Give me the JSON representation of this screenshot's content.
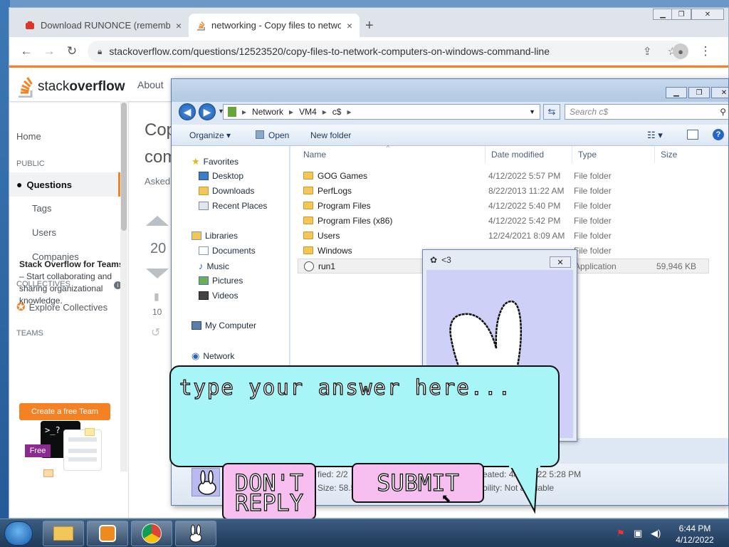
{
  "browser": {
    "tabs": [
      {
        "title": "Download RUNONCE (remember",
        "close": "×"
      },
      {
        "title": "networking - Copy files to netwo",
        "close": "×"
      }
    ],
    "new_tab": "+",
    "url": "stackoverflow.com/questions/12523520/copy-files-to-network-computers-on-windows-command-line"
  },
  "so": {
    "logo_plain": "stack",
    "logo_bold": "overflow",
    "about": "About",
    "home": "Home",
    "public": "PUBLIC",
    "questions": "Questions",
    "tags": "Tags",
    "users": "Users",
    "companies": "Companies",
    "collectives": "COLLECTIVES",
    "explore": "Explore Collectives",
    "teams": "TEAMS",
    "teams_title": "Stack Overflow for Teams",
    "teams_desc": "– Start collaborating and sharing organizational knowledge.",
    "free_badge": "Free",
    "create_team": "Create a free Team",
    "title_partial_1": "Cop",
    "title_partial_2": "com",
    "asked_partial": "Asked",
    "vote_count": "20",
    "bookmark_count": "10"
  },
  "explorer": {
    "breadcrumb": [
      "Network",
      "VM4",
      "c$"
    ],
    "search_placeholder": "Search c$",
    "commands": {
      "organize": "Organize ▾",
      "open": "Open",
      "new_folder": "New folder"
    },
    "nav": {
      "favorites": "Favorites",
      "desktop": "Desktop",
      "downloads": "Downloads",
      "recent": "Recent Places",
      "libraries": "Libraries",
      "documents": "Documents",
      "music": "Music",
      "pictures": "Pictures",
      "videos": "Videos",
      "computer": "My Computer",
      "network": "Network"
    },
    "columns": {
      "name": "Name",
      "date": "Date modified",
      "type": "Type",
      "size": "Size"
    },
    "rows": [
      {
        "name": "GOG Games",
        "date": "4/12/2022 5:57 PM",
        "type": "File folder",
        "size": ""
      },
      {
        "name": "PerfLogs",
        "date": "8/22/2013 11:22 AM",
        "type": "File folder",
        "size": ""
      },
      {
        "name": "Program Files",
        "date": "4/12/2022 5:40 PM",
        "type": "File folder",
        "size": ""
      },
      {
        "name": "Program Files (x86)",
        "date": "4/12/2022 5:42 PM",
        "type": "File folder",
        "size": ""
      },
      {
        "name": "Users",
        "date": "12/24/2021 8:09 AM",
        "type": "File folder",
        "size": ""
      },
      {
        "name": "Windows",
        "date": "",
        "type": "File folder",
        "size": ""
      },
      {
        "name": "run1",
        "date": "",
        "type": "Application",
        "size": "59,946 KB"
      }
    ],
    "details": {
      "modified_partial": "fied: 2/2",
      "size_partial": "Size: 58.5",
      "created_partial": "eated: 4/12/2022 5:28 PM",
      "avail_partial": "bility: Not available"
    }
  },
  "mini_window": {
    "title": "<3",
    "close": "✕"
  },
  "bubble": {
    "prompt": "type your answer here...",
    "dont_reply": "DON'T REPLY",
    "submit": "SUBMIT"
  },
  "taskbar": {
    "time": "6:44 PM",
    "date": "4/12/2022"
  },
  "colors": {
    "so_orange": "#f48225",
    "bubble": "#a7f5f6",
    "button_pink": "#f6bff0"
  }
}
